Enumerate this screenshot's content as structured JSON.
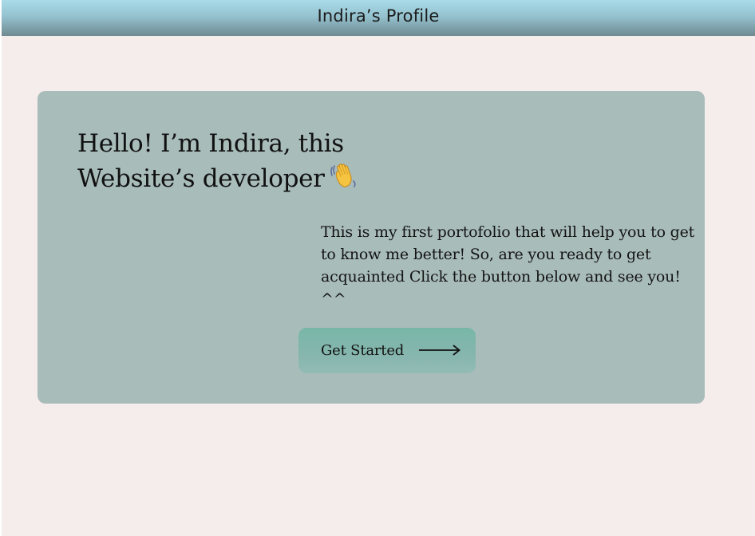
{
  "header": {
    "title": "Indira’s Profile"
  },
  "hero": {
    "headline_line1": "Hello! I’m Indira, this",
    "headline_line2": "Website’s developer",
    "wave_icon": "waving-hand-icon",
    "intro_text": "This is my first portofolio that will help you to get to know me better! So, are you ready to get acquainted Click the button below and see you! ^^",
    "cta_label": "Get Started",
    "cta_icon": "long-arrow-right-icon"
  },
  "colors": {
    "page_background": "#f5ecec",
    "header_gradient_top": "#a9dbe9",
    "header_gradient_bottom": "#6f8a91",
    "card_background": "#a8bcba",
    "button_background": "#86b6ae"
  }
}
